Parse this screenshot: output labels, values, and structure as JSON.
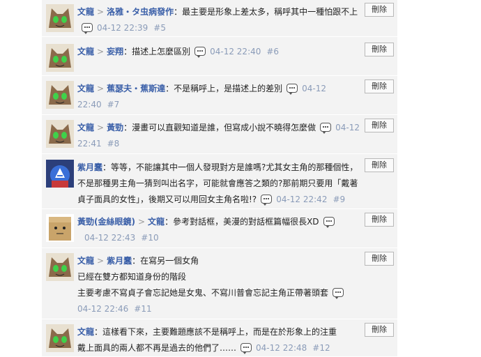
{
  "delete_label": "刪除",
  "comments": [
    {
      "author": "文龍",
      "target": "洛雅・タ虫病發作",
      "text": "：最主要是形象上差太多，稱呼其中一種怕跟不上",
      "time": "04-12 22:39",
      "floor": "#5",
      "avatar": "cat"
    },
    {
      "author": "文龍",
      "target": "妄翔",
      "text": "：描述上怎麼區別",
      "time": "04-12 22:40",
      "floor": "#6",
      "avatar": "cat"
    },
    {
      "author": "文龍",
      "target": "蕉瑟夫・蕉斯達",
      "text": "：不是稱呼上，是描述上的差別",
      "time": "04-12 22:40",
      "floor": "#7",
      "avatar": "cat"
    },
    {
      "author": "文龍",
      "target": "黃勁",
      "text": "：漫畫可以直觀知道是誰，但寫成小說不曉得怎麼做",
      "time": "04-12 22:41",
      "floor": "#8",
      "avatar": "cat"
    },
    {
      "author": "紫月蠢",
      "target": "",
      "text": "：等等，不能讓其中一個人發現對方是誰嗎?尤其女主角的那種個性，不是那種男主角一猜到叫出名字，可能就會應答之類的?那前期只要用「戴著貞子面具的女性」，後期又可以用回女主角名啦!?",
      "time": "04-12 22:42",
      "floor": "#9",
      "avatar": "captain"
    },
    {
      "author": "黃勁(金絲眼鏡)",
      "target": "文龍",
      "text": "：參考對話框，美漫的對話框篇幅很長XD",
      "time": "04-12 22:43",
      "floor": "#10",
      "avatar": "box"
    },
    {
      "author": "文龍",
      "target": "紫月蠢",
      "text": "：在寫另一個女角",
      "line2": "已經在雙方都知道身份的階段",
      "line3": "主要考慮不寫貞子會忘記她是女鬼、不寫川普會忘記主角正帶著頭套",
      "time": "04-12 22:46",
      "floor": "#11",
      "avatar": "cat"
    },
    {
      "author": "文龍",
      "target": "",
      "text": "：這樣看下來，主要難題應該不是稱呼上，而是在於形象上的注重",
      "line2": "戴上面具的兩人都不再是過去的他們了……",
      "time": "04-12 22:48",
      "floor": "#12",
      "avatar": "cat"
    }
  ]
}
